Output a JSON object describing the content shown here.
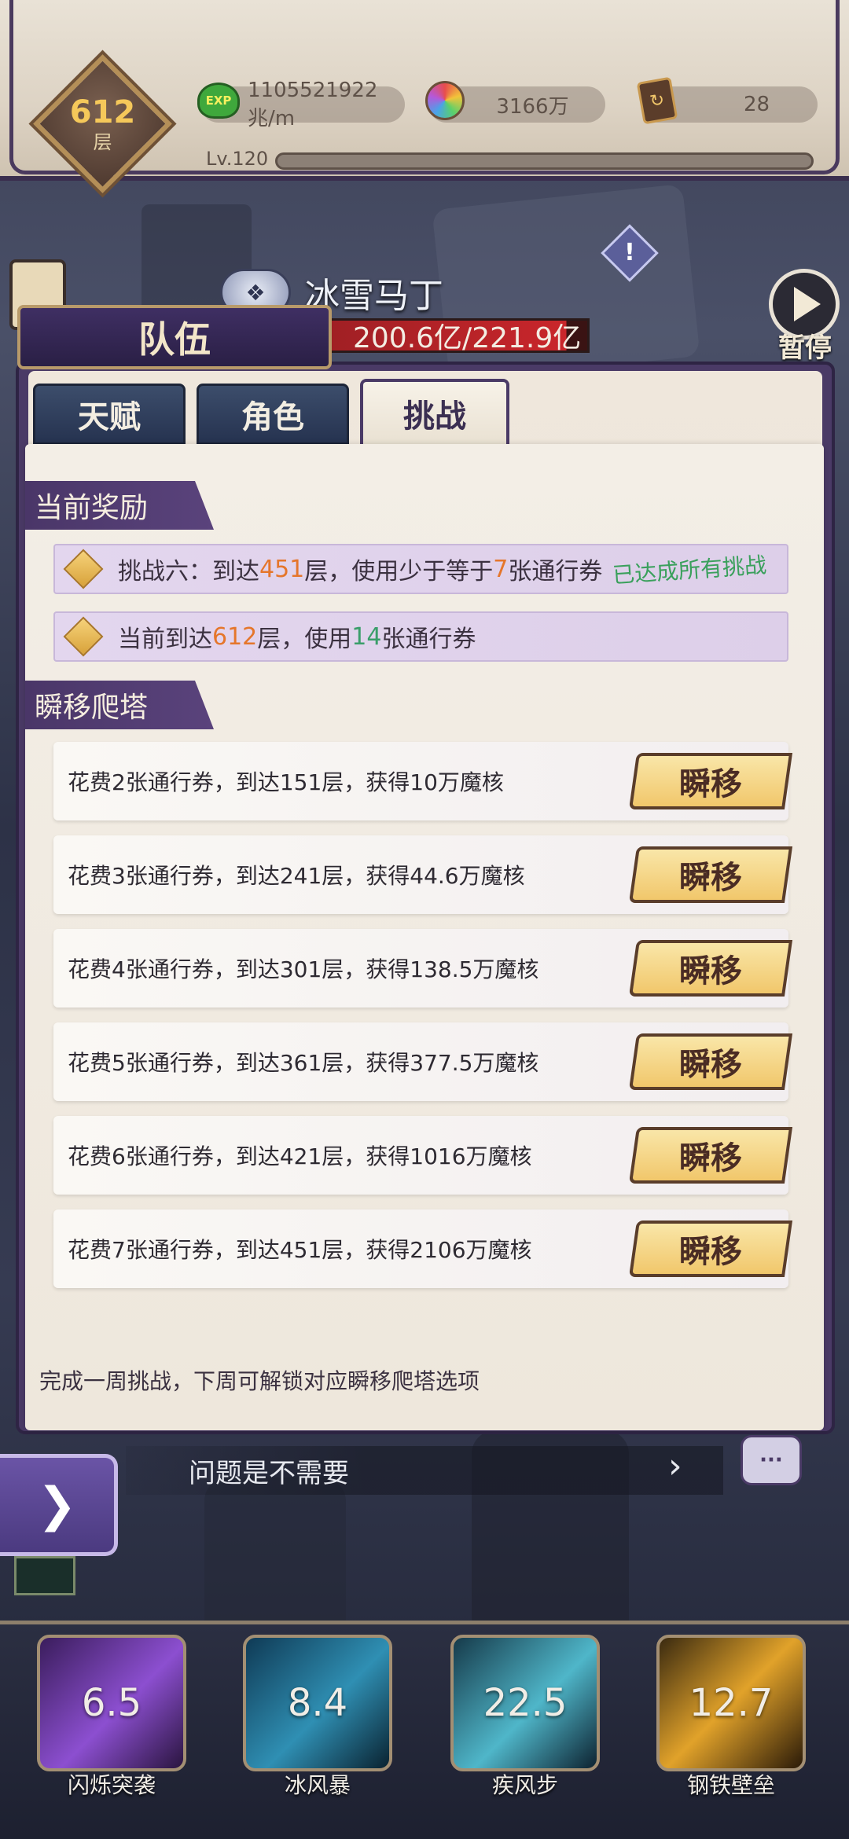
{
  "hud": {
    "floor_number": "612",
    "floor_unit": "层",
    "exp_icon_text": "EXP",
    "exp_rate": "1105521922兆/m",
    "magic_core": "3166万",
    "tickets": "28",
    "level": "Lv.120"
  },
  "hero": {
    "name": "冰雪马丁",
    "hp_text": "200.6亿/221.9亿"
  },
  "pause": {
    "label": "暂停"
  },
  "panel": {
    "banner": "队伍",
    "tabs": [
      {
        "label": "天赋",
        "active": false
      },
      {
        "label": "角色",
        "active": false
      },
      {
        "label": "挑战",
        "active": true
      }
    ],
    "current_reward": {
      "header": "当前奖励",
      "row1": {
        "prefix": "挑战六：到达",
        "floor": "451",
        "mid": "层，使用少于等于",
        "count": "7",
        "suffix": "张通行券",
        "status": "已达成所有挑战"
      },
      "row2": {
        "prefix": "当前到达",
        "floor": "612",
        "mid": "层，使用",
        "count": "14",
        "suffix": "张通行券"
      }
    },
    "teleport": {
      "header": "瞬移爬塔",
      "button_label": "瞬移",
      "rows": [
        {
          "text": "花费2张通行券，到达151层，获得10万魔核"
        },
        {
          "text": "花费3张通行券，到达241层，获得44.6万魔核"
        },
        {
          "text": "花费4张通行券，到达301层，获得138.5万魔核"
        },
        {
          "text": "花费5张通行券，到达361层，获得377.5万魔核"
        },
        {
          "text": "花费6张通行券，到达421层，获得1016万魔核"
        },
        {
          "text": "花费7张通行券，到达451层，获得2106万魔核"
        }
      ]
    },
    "footer_note": "完成一周挑战，下周可解锁对应瞬移爬塔选项"
  },
  "chat": {
    "message": "问题是不需要",
    "arrow": "›",
    "bubble": "···"
  },
  "skills": [
    {
      "name": "闪烁突袭",
      "cooldown": "6.5"
    },
    {
      "name": "冰风暴",
      "cooldown": "8.4"
    },
    {
      "name": "疾风步",
      "cooldown": "22.5"
    },
    {
      "name": "钢铁壁垒",
      "cooldown": "12.7"
    }
  ]
}
